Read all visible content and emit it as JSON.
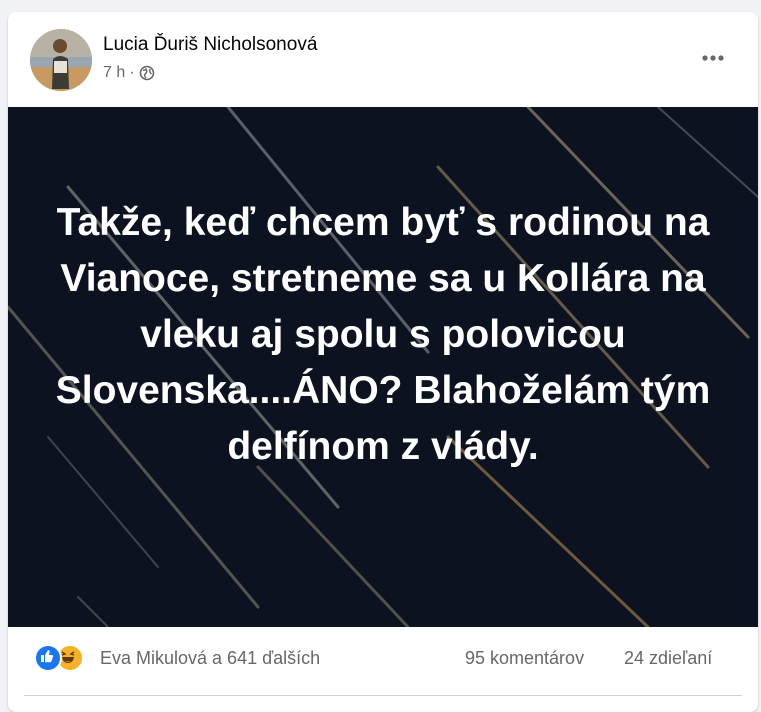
{
  "post": {
    "author": "Lucia Ďuriš Nicholsonová",
    "time": "7 h",
    "separator": "·",
    "privacy_icon": "globe-icon",
    "more_icon": "more-options-icon",
    "image_text": "Takže, keď chcem byť s rodinou na Vianoce, stretneme sa u Kollára na vleku aj spolu s polovicou Slovenska....ÁNO? Blahoželám tým delfínom z vlády.",
    "image_background": "#0c1220"
  },
  "stats": {
    "reaction_icons": [
      "like-icon",
      "haha-icon"
    ],
    "reactors": "Eva Mikulová a 641 ďalších",
    "comments": "95 komentárov",
    "shares": "24 zdieľaní"
  },
  "colors": {
    "accent": "#1877f2",
    "haha": "#f7b125",
    "secondary_text": "#65676b"
  }
}
